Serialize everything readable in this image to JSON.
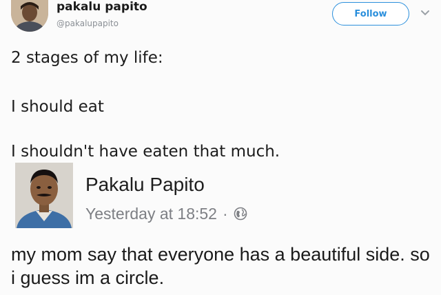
{
  "tweet": {
    "author_name": "pakalu papito",
    "author_handle": "@pakalupapito",
    "follow_label": "Follow",
    "lines": [
      "2 stages of my life:",
      "I should eat",
      "I shouldn't have eaten that much."
    ]
  },
  "facebook_post": {
    "author_name": "Pakalu Papito",
    "timestamp": "Yesterday at 18:52",
    "separator": "·",
    "privacy_icon": "globe-icon",
    "text": "my mom say that everyone has a beautiful side. so i guess im a circle."
  },
  "colors": {
    "follow_accent": "#2a8fdc",
    "handle_gray": "#8a8f95",
    "meta_gray": "#7d7f84",
    "background": "#fbfbfb"
  }
}
